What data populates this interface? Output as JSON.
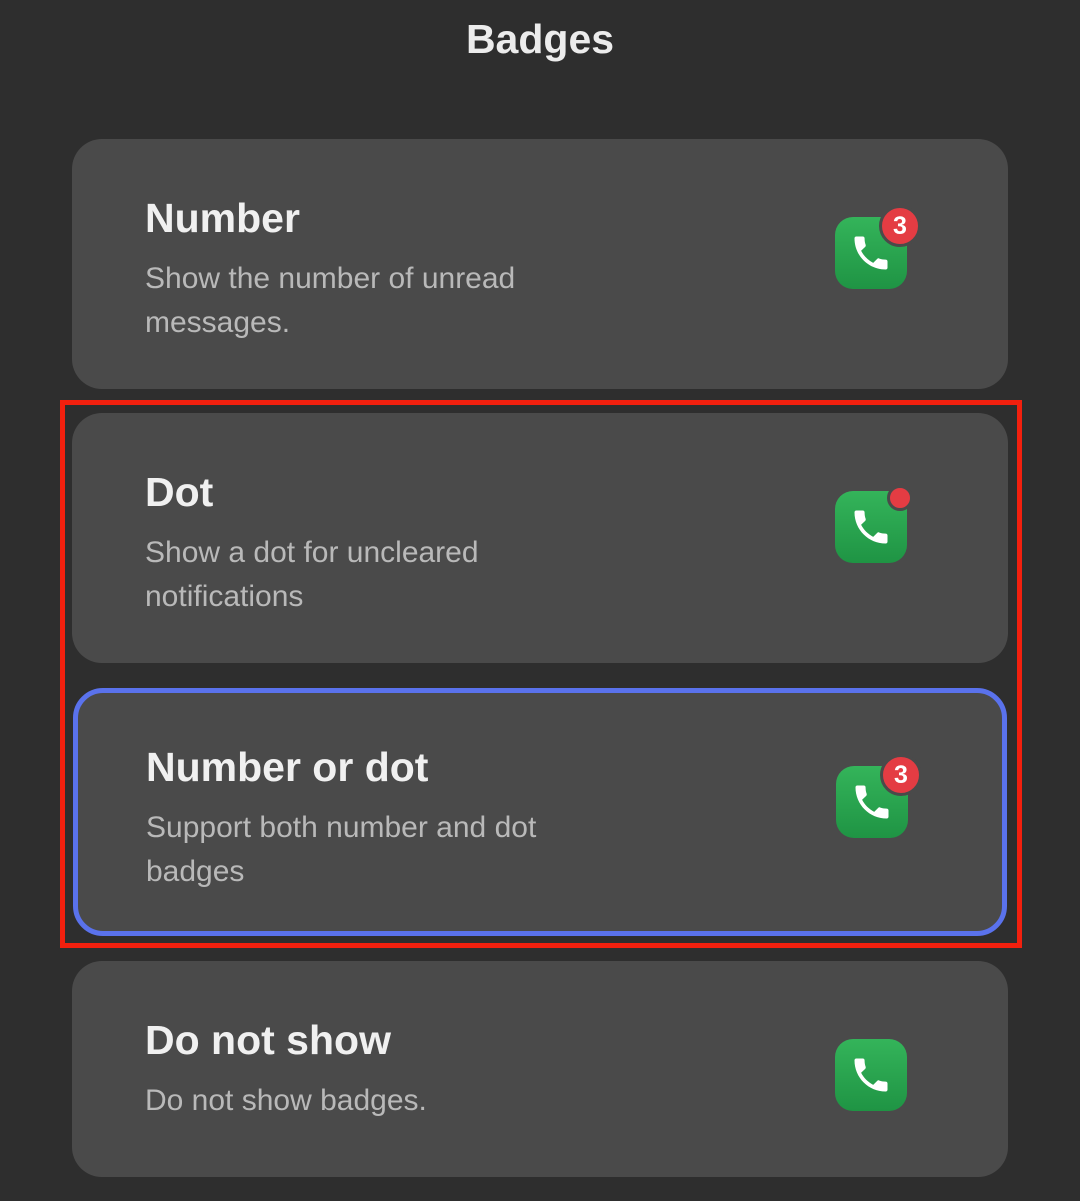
{
  "header": {
    "title": "Badges"
  },
  "options": [
    {
      "title": "Number",
      "description": "Show the number of unread messages.",
      "badge_type": "number",
      "badge_value": "3",
      "selected": false
    },
    {
      "title": "Dot",
      "description": "Show a dot for uncleared notifications",
      "badge_type": "dot",
      "selected": false
    },
    {
      "title": "Number or dot",
      "description": "Support both number and dot badges",
      "badge_type": "number",
      "badge_value": "3",
      "selected": true
    },
    {
      "title": "Do not show",
      "description": "Do not show badges.",
      "badge_type": "none",
      "selected": false
    }
  ],
  "icons": {
    "app_icon": "phone-icon"
  },
  "colors": {
    "background": "#2e2e2e",
    "card": "#4a4a4a",
    "selected_border": "#5a72ec",
    "highlight_border": "#f2200e",
    "badge": "#e43c43",
    "app_icon": "#2aa451"
  }
}
